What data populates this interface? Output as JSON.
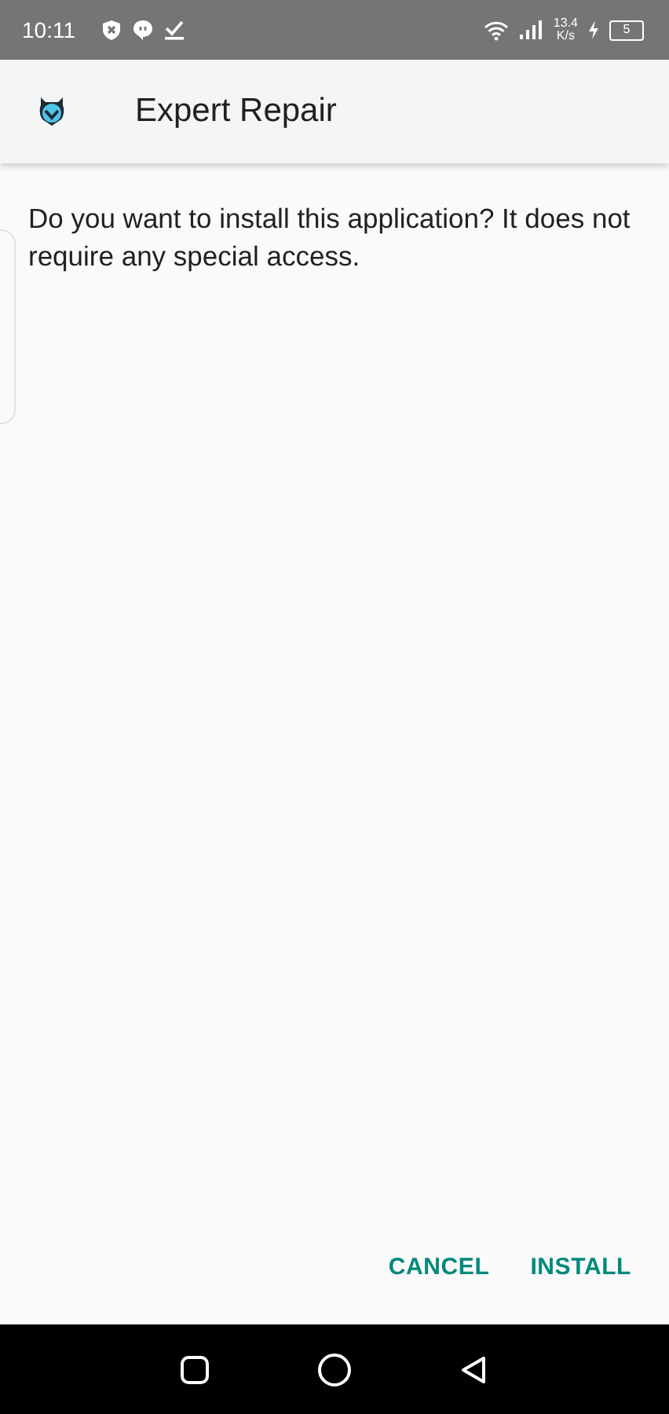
{
  "status_bar": {
    "time": "10:11",
    "speed_value": "13.4",
    "speed_unit": "K/s",
    "battery": "5"
  },
  "app_bar": {
    "title": "Expert Repair"
  },
  "message": "Do you want to install this application? It does not require any special access.",
  "buttons": [
    {
      "label": "CANCEL"
    },
    {
      "label": "INSTALL"
    }
  ]
}
